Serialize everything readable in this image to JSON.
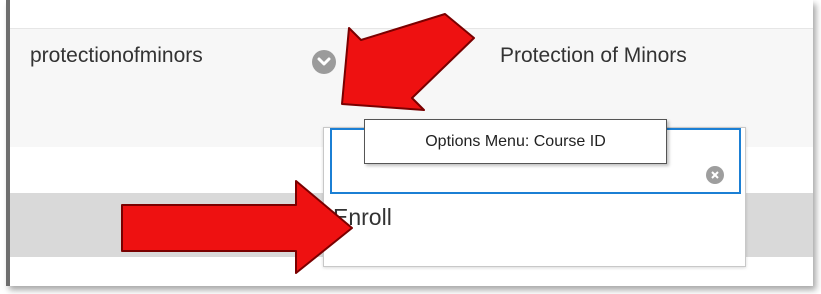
{
  "course": {
    "id": "protectionofminors",
    "name": "Protection of Minors"
  },
  "tooltip": {
    "text": "Options Menu: Course ID"
  },
  "menu": {
    "items": [
      {
        "label": "Enroll"
      }
    ]
  },
  "icons": {
    "options": "chevron-down-icon",
    "clear": "clear-icon",
    "annotation": "red-arrow-icon"
  },
  "colors": {
    "focus_border": "#1b7fd4",
    "annotation_arrow": "#ee1111",
    "row_background": "#f7f7f7",
    "band_background": "#d9d9d9"
  }
}
